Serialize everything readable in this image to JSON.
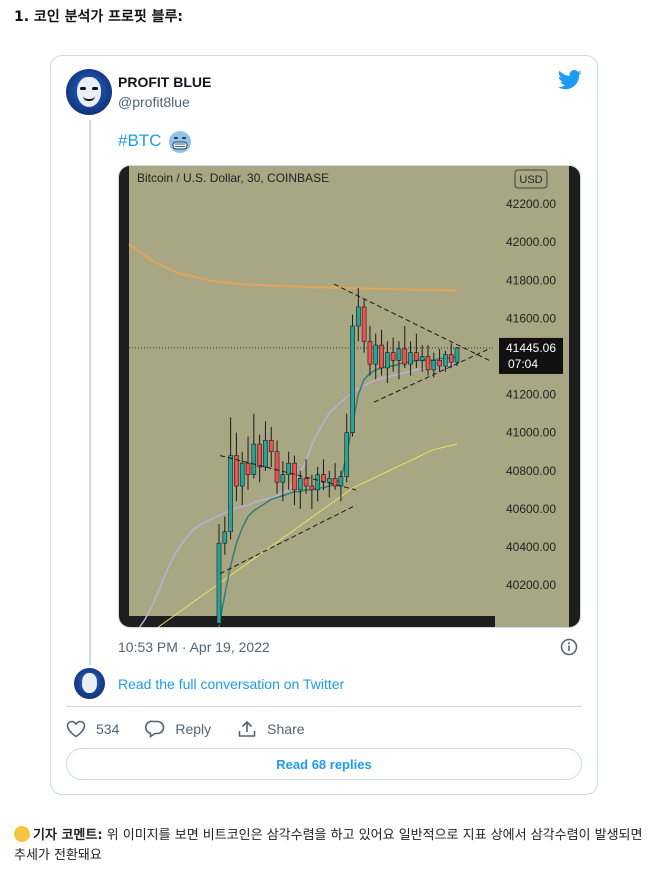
{
  "article": {
    "heading": "1. 코인 분석가 프로핏 블루:",
    "comment_label": "기자 코멘트:",
    "comment_text": " 위 이미지를 보면 비트코인은 삼각수렴을 하고 있어요  일반적으로 지표 상에서 삼각수렴이 발생되면 추세가 전환돼요",
    "comment_icon": "thinking-face-icon"
  },
  "tweet": {
    "display_name": "PROFIT BLUE",
    "handle": "@profit8lue",
    "hashtag": "#BTC",
    "hashtag_emoji": "face-with-mask-emoji",
    "timestamp": "10:53 PM · Apr 19, 2022",
    "read_conversation": "Read the full conversation on Twitter",
    "likes": "534",
    "reply_label": "Reply",
    "share_label": "Share",
    "read_replies": "Read 68 replies",
    "brand_icon": "twitter-bird-icon",
    "accent_color": "#1d9bf0"
  },
  "chart_data": {
    "type": "candlestick",
    "title": "Bitcoin / U.S. Dollar, 30, COINBASE",
    "currency_label": "USD",
    "y_ticks": [
      "42200.00",
      "42000.00",
      "41800.00",
      "41600.00",
      "41200.00",
      "41000.00",
      "40800.00",
      "40600.00",
      "40400.00",
      "40200.00"
    ],
    "ylim": [
      39980,
      42400
    ],
    "current_price": "41445.06",
    "countdown": "07:04",
    "background_color": "#a9a683",
    "up_color": "#26a69a",
    "down_color": "#ef5350",
    "candles": [
      [
        40000,
        40520,
        39990,
        40420
      ],
      [
        40420,
        40560,
        40360,
        40480
      ],
      [
        40480,
        41080,
        40440,
        40880
      ],
      [
        40880,
        41000,
        40640,
        40720
      ],
      [
        40720,
        40900,
        40620,
        40840
      ],
      [
        40840,
        40980,
        40700,
        40780
      ],
      [
        40780,
        41100,
        40760,
        40940
      ],
      [
        40940,
        40990,
        40740,
        40820
      ],
      [
        40820,
        41060,
        40800,
        40960
      ],
      [
        40960,
        41030,
        40820,
        40900
      ],
      [
        40900,
        40960,
        40680,
        40740
      ],
      [
        40740,
        40850,
        40640,
        40780
      ],
      [
        40780,
        40900,
        40700,
        40840
      ],
      [
        40840,
        40880,
        40620,
        40700
      ],
      [
        40700,
        40800,
        40600,
        40760
      ],
      [
        40760,
        40860,
        40680,
        40720
      ],
      [
        40720,
        40780,
        40600,
        40700
      ],
      [
        40700,
        40820,
        40640,
        40780
      ],
      [
        40780,
        40860,
        40700,
        40740
      ],
      [
        40740,
        40800,
        40660,
        40760
      ],
      [
        40760,
        40840,
        40700,
        40720
      ],
      [
        40720,
        40800,
        40640,
        40770
      ],
      [
        40770,
        41100,
        40740,
        41000
      ],
      [
        41000,
        41620,
        40980,
        41560
      ],
      [
        41560,
        41760,
        41480,
        41660
      ],
      [
        41660,
        41700,
        41420,
        41480
      ],
      [
        41480,
        41560,
        41300,
        41360
      ],
      [
        41360,
        41520,
        41280,
        41460
      ],
      [
        41460,
        41540,
        41300,
        41340
      ],
      [
        41340,
        41480,
        41260,
        41420
      ],
      [
        41420,
        41500,
        41320,
        41380
      ],
      [
        41380,
        41480,
        41280,
        41440
      ],
      [
        41440,
        41560,
        41340,
        41360
      ],
      [
        41360,
        41480,
        41300,
        41420
      ],
      [
        41420,
        41520,
        41340,
        41380
      ],
      [
        41380,
        41460,
        41320,
        41400
      ],
      [
        41400,
        41460,
        41300,
        41330
      ],
      [
        41330,
        41420,
        41290,
        41380
      ],
      [
        41380,
        41440,
        41320,
        41350
      ],
      [
        41350,
        41430,
        41320,
        41410
      ],
      [
        41410,
        41470,
        41340,
        41370
      ],
      [
        41370,
        41450,
        41350,
        41445
      ]
    ],
    "orange_ma": [
      41990,
      41960,
      41930,
      41900,
      41880,
      41860,
      41840,
      41830,
      41820,
      41810,
      41800,
      41795,
      41790,
      41785,
      41780,
      41778,
      41776,
      41774,
      41772,
      41770,
      41768,
      41766,
      41765,
      41764,
      41763,
      41762,
      41761,
      41760,
      41759,
      41758,
      41757,
      41756,
      41755,
      41754,
      41753,
      41752,
      41751,
      41750,
      41750,
      41749,
      41748,
      41748
    ],
    "teal_ma": [
      39980,
      40150,
      40300,
      40420,
      40500,
      40560,
      40590,
      40610,
      40630,
      40650,
      40660,
      40670,
      40680,
      40690,
      40690,
      40700,
      40700,
      40710,
      40710,
      40720,
      40730,
      40760,
      40880,
      41050,
      41200,
      41280,
      41310,
      41330,
      41340,
      41350,
      41350,
      41360,
      41370,
      41370,
      41380,
      41380,
      41380,
      41380,
      41390,
      41390,
      41390,
      41400
    ],
    "purple_ma": [
      39900,
      39960,
      40020,
      40100,
      40200,
      40300,
      40380,
      40440,
      40490,
      40520,
      40540,
      40560,
      40580,
      40600,
      40610,
      40620,
      40640,
      40650,
      40660,
      40680,
      40700,
      40760,
      40840,
      40950,
      41030,
      41100,
      41140,
      41180,
      41210,
      41240,
      41260,
      41280,
      41290,
      41300,
      41310,
      41320,
      41330,
      41340,
      41345,
      41350,
      41360,
      41370
    ],
    "yellow_ma": [
      39900,
      39920,
      39940,
      39960,
      39990,
      40020,
      40050,
      40080,
      40110,
      40140,
      40170,
      40200,
      40230,
      40260,
      40290,
      40320,
      40350,
      40380,
      40410,
      40440,
      40470,
      40500,
      40530,
      40560,
      40590,
      40620,
      40650,
      40680,
      40710,
      40730,
      40750,
      40770,
      40790,
      40810,
      40830,
      40850,
      40870,
      40890,
      40910,
      40920,
      40930,
      40940
    ]
  }
}
